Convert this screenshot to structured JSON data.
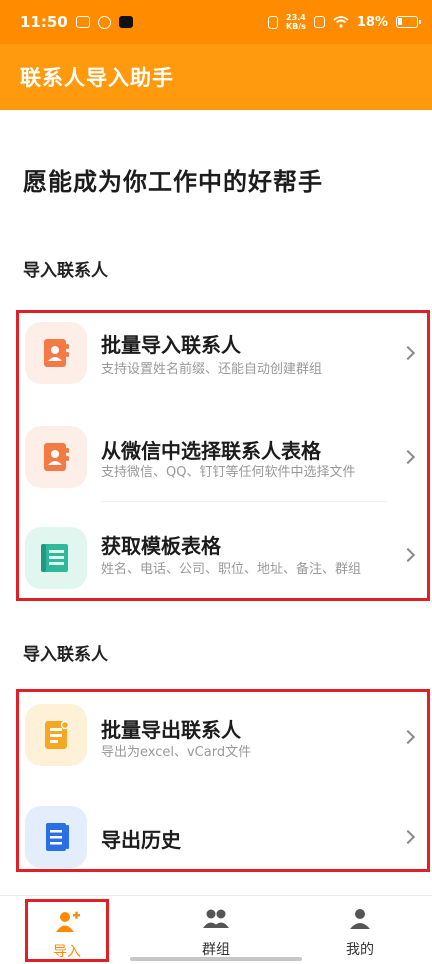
{
  "status_bar": {
    "time": "11:50",
    "speed_value": "23.4",
    "speed_unit": "KB/s",
    "battery": "18%"
  },
  "app_bar": {
    "title": "联系人导入助手"
  },
  "slogan": "愿能成为你工作中的好帮手",
  "import_section": {
    "title": "导入联系人",
    "items": [
      {
        "title": "批量导入联系人",
        "subtitle": "支持设置姓名前缀、还能自动创建群组",
        "icon": "contact-book-icon"
      },
      {
        "title": "从微信中选择联系人表格",
        "subtitle": "支持微信、QQ、钉钉等任何软件中选择文件",
        "icon": "contact-book-icon"
      },
      {
        "title": "获取模板表格",
        "subtitle": "姓名、电话、公司、职位、地址、备注、群组",
        "icon": "template-sheet-icon"
      }
    ]
  },
  "export_section": {
    "title": "导入联系人",
    "items": [
      {
        "title": "批量导出联系人",
        "subtitle": "导出为excel、vCard文件",
        "icon": "export-doc-icon"
      },
      {
        "title": "导出历史",
        "subtitle": "",
        "icon": "history-book-icon"
      }
    ]
  },
  "bottom_nav": {
    "items": [
      {
        "label": "导入",
        "icon": "add-person-icon",
        "active": true
      },
      {
        "label": "群组",
        "icon": "group-icon",
        "active": false
      },
      {
        "label": "我的",
        "icon": "person-icon",
        "active": false
      }
    ]
  },
  "colors": {
    "status_bar": "#ff8c00",
    "app_bar": "#ff9a0f",
    "accent": "#ff9a0f",
    "highlight_border": "#e11f26",
    "contact_icon": "#f47a45",
    "template_icon": "#2fb89a",
    "export_icon": "#f5a623",
    "history_icon": "#2a6fe6"
  }
}
